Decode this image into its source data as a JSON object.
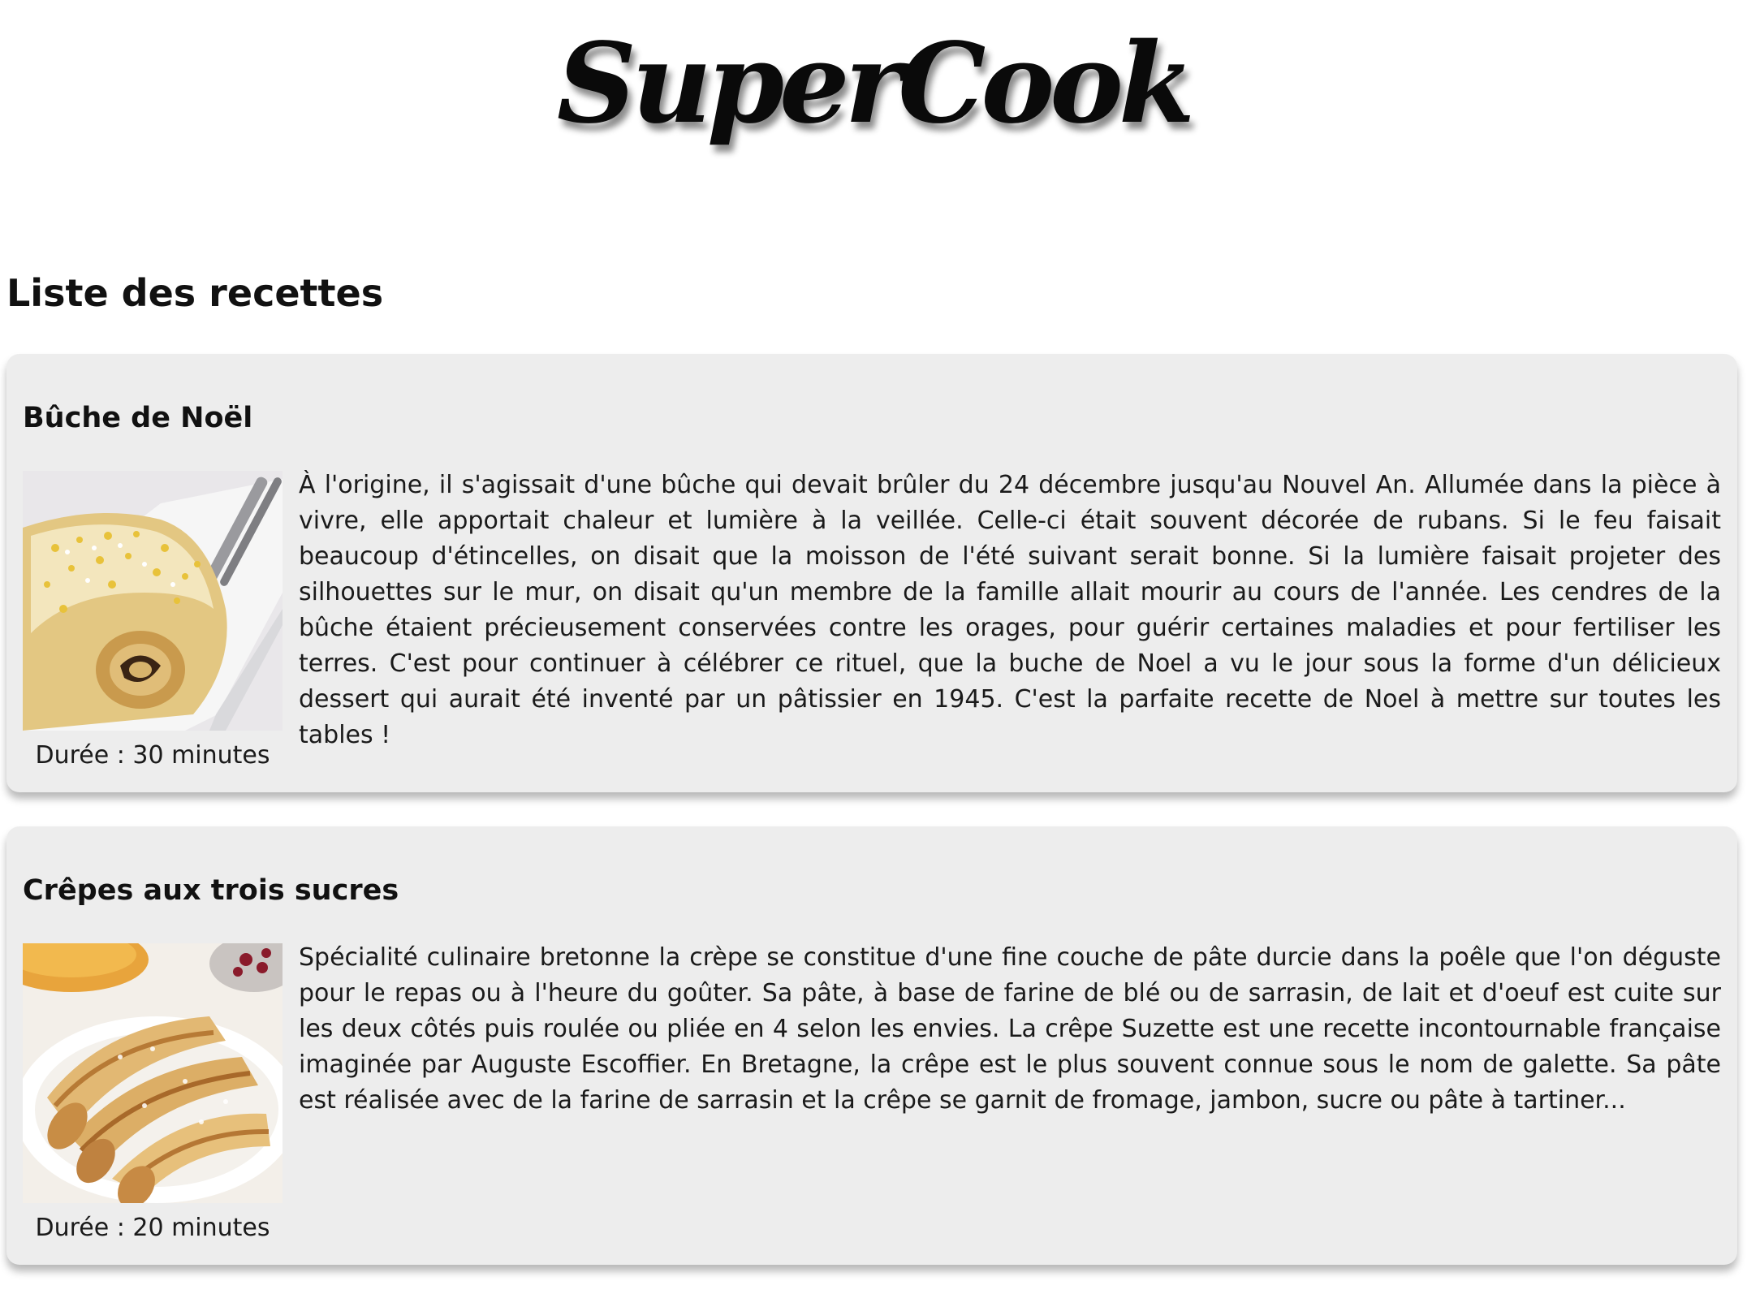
{
  "header": {
    "logo_text": "SuperCook"
  },
  "main": {
    "section_title": "Liste des recettes",
    "recipes": [
      {
        "title": "Bûche de Noël",
        "description": "À l'origine, il s'agissait d'une bûche qui devait brûler du 24 décembre jusqu'au Nouvel An. Allumée dans la pièce à vivre, elle apportait chaleur et lumière à la veillée. Celle-ci était souvent décorée de rubans. Si le feu faisait beaucoup d'étincelles, on disait que la moisson de l'été suivant serait bonne. Si la lumière faisait projeter des silhouettes sur le mur, on disait qu'un membre de la famille allait mourir au cours de l'année. Les cendres de la bûche étaient précieusement conservées contre les orages, pour guérir certaines maladies et pour fertiliser les terres. C'est pour continuer à célébrer ce rituel, que la buche de Noel a vu le jour sous la forme d'un délicieux dessert qui aurait été inventé par un pâtissier en 1945. C'est la parfaite recette de Noel à mettre sur toutes les tables !",
        "duration": "Durée : 30 minutes"
      },
      {
        "title": "Crêpes aux trois sucres",
        "description": "Spécialité culinaire bretonne la crèpe se constitue d'une fine couche de pâte durcie dans la poêle que l'on déguste pour le repas ou à l'heure du goûter. Sa pâte, à base de farine de blé ou de sarrasin, de lait et d'oeuf est cuite sur les deux côtés puis roulée ou pliée en 4 selon les envies. La crêpe Suzette est une recette incontournable française imaginée par Auguste Escoffier. En Bretagne, la crêpe est le plus souvent connue sous le nom de galette. Sa pâte est réalisée avec de la farine de sarrasin et la crêpe se garnit de fromage, jambon, sucre ou pâte à tartiner...",
        "duration": "Durée : 20 minutes"
      }
    ]
  },
  "colors": {
    "card_background": "#ededed",
    "text": "#111111",
    "page_background": "#ffffff"
  }
}
